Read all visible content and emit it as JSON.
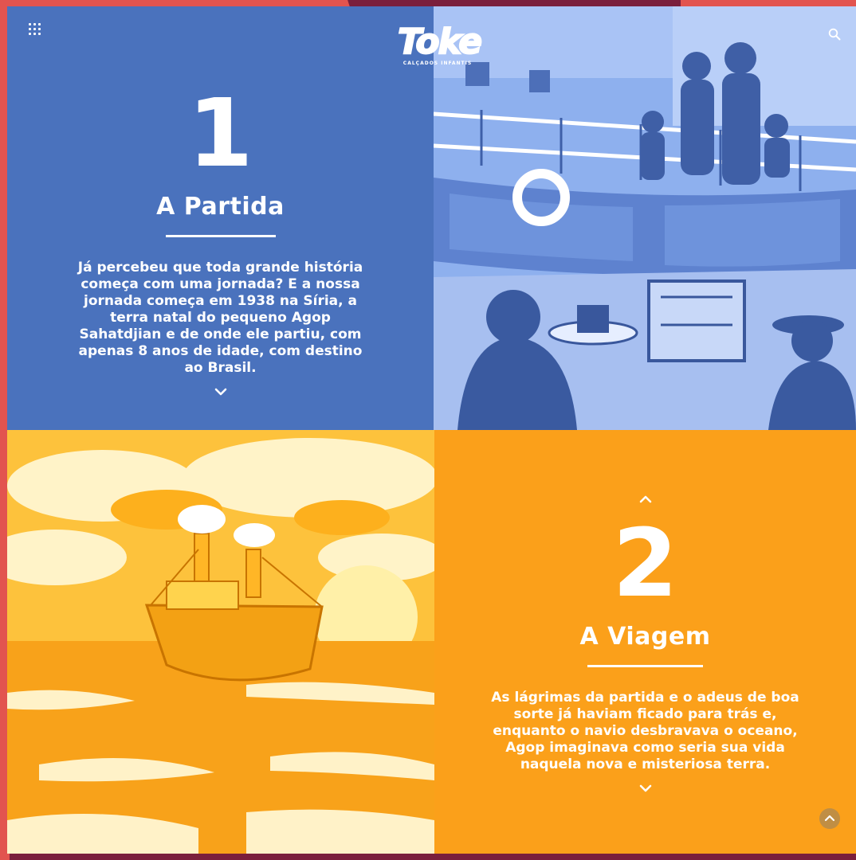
{
  "header": {
    "brand_name": "Toke",
    "brand_tagline": "CALÇADOS INFANTIS",
    "menu_icon": "grid-menu-icon",
    "search_icon": "search-icon"
  },
  "chapters": [
    {
      "number": "1",
      "title": "A Partida",
      "text": "Já percebeu que toda grande história começa com uma jornada? E a nossa jornada começa em 1938 na Síria, a terra natal do pequeno Agop Sahatdjian e de onde ele partiu, com apenas 8 anos de idade, com destino ao Brasil.",
      "color": "#4a72bd"
    },
    {
      "number": "2",
      "title": "A Viagem",
      "text": "As lágrimas da partida e o adeus de boa sorte já haviam ficado para trás e, enquanto o navio desbravava o oceano, Agop imaginava como seria sua vida naquela nova e misteriosa terra.",
      "color": "#fba01a"
    }
  ],
  "colors": {
    "blue_panel": "#4a72bd",
    "blue_illustration": "#7d9fe0",
    "orange_panel": "#fba01a",
    "yellow_illustration": "#fdb01d",
    "background": "#7a1f3c",
    "accent_red": "#e2544f"
  }
}
